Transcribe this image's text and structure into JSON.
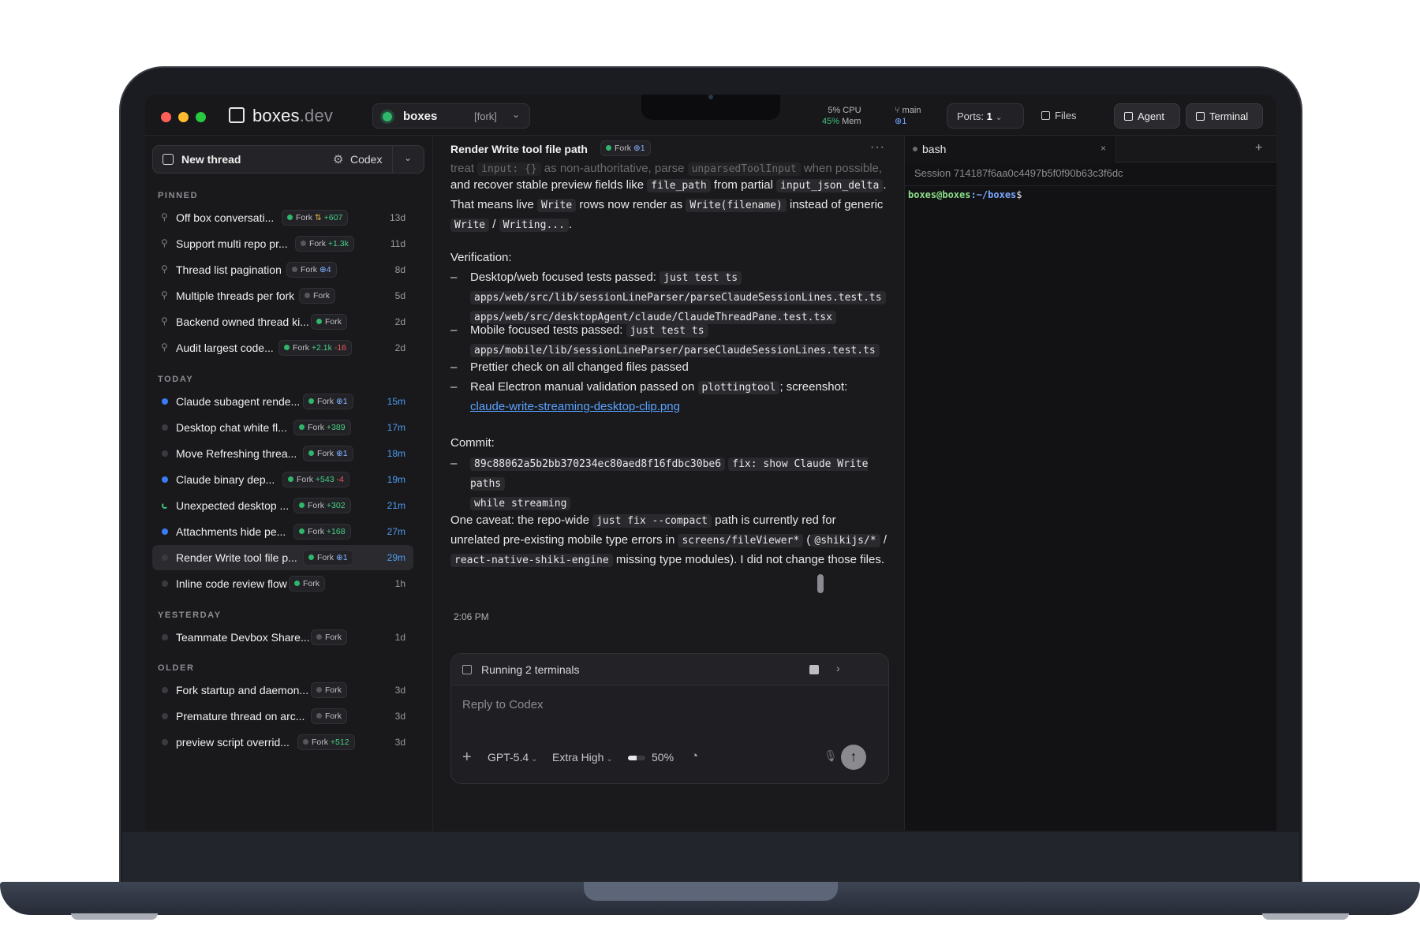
{
  "window": {
    "logo_main": "boxes",
    "logo_dim": ".dev",
    "repo": {
      "name": "boxes",
      "tag": "[fork]"
    },
    "stats": {
      "cpu": "5% CPU",
      "mem_pct": "45%",
      "mem_label": " Mem",
      "branch": "main",
      "pr": "⊕1"
    },
    "ports_label": "Ports:",
    "ports_count": "1",
    "files_label": "Files",
    "agent_label": "Agent",
    "terminal_label": "Terminal"
  },
  "sidebar": {
    "new_thread": "New thread",
    "agent": "Codex",
    "sections": {
      "pinned": "PINNED",
      "today": "TODAY",
      "yesterday": "YESTERDAY",
      "older": "OLDER"
    },
    "pinned": [
      {
        "title": "Off box conversati...",
        "fork": "Fork",
        "extra_icon": "⇅",
        "add": "+607",
        "del": "",
        "pr": "",
        "age": "13d"
      },
      {
        "title": "Support multi repo pr...",
        "fork": "Fork",
        "add": "+1.3k",
        "del": "",
        "pr": "",
        "age": "11d"
      },
      {
        "title": "Thread list pagination",
        "fork": "Fork",
        "add": "",
        "del": "",
        "pr": "⊕4",
        "age": "8d"
      },
      {
        "title": "Multiple threads per fork",
        "fork": "Fork",
        "add": "",
        "del": "",
        "pr": "",
        "age": "5d"
      },
      {
        "title": "Backend owned thread ki...",
        "fork": "Fork",
        "add": "",
        "del": "",
        "pr": "",
        "age": "2d"
      },
      {
        "title": "Audit largest code...",
        "fork": "Fork",
        "add": "+2.1k",
        "del": "-16",
        "pr": "",
        "age": "2d"
      }
    ],
    "today": [
      {
        "title": "Claude subagent rende...",
        "fork": "Fork",
        "add": "",
        "del": "",
        "pr": "⊕1",
        "age": "15m"
      },
      {
        "title": "Desktop chat white fl...",
        "fork": "Fork",
        "add": "+389",
        "del": "",
        "pr": "",
        "age": "17m"
      },
      {
        "title": "Move Refreshing threa...",
        "fork": "Fork",
        "add": "",
        "del": "",
        "pr": "⊕1",
        "age": "18m"
      },
      {
        "title": "Claude binary dep...",
        "fork": "Fork",
        "add": "+543",
        "del": "-4",
        "pr": "",
        "age": "19m"
      },
      {
        "title": "Unexpected desktop ...",
        "fork": "Fork",
        "add": "+302",
        "del": "",
        "pr": "",
        "age": "21m"
      },
      {
        "title": "Attachments hide pe...",
        "fork": "Fork",
        "add": "+168",
        "del": "",
        "pr": "",
        "age": "27m"
      },
      {
        "title": "Render Write tool file p...",
        "fork": "Fork",
        "add": "",
        "del": "",
        "pr": "⊕1",
        "age": "29m"
      },
      {
        "title": "Inline code review flow",
        "fork": "Fork",
        "add": "",
        "del": "",
        "pr": "",
        "age": "1h"
      }
    ],
    "yesterday": [
      {
        "title": "Teammate Devbox Share...",
        "fork": "Fork",
        "age": "1d"
      }
    ],
    "older": [
      {
        "title": "Fork startup and daemon...",
        "fork": "Fork",
        "add": "",
        "age": "3d"
      },
      {
        "title": "Premature thread on arc...",
        "fork": "Fork",
        "add": "",
        "age": "3d"
      },
      {
        "title": "preview script overrid...",
        "fork": "Fork",
        "add": "+512",
        "age": "3d"
      }
    ]
  },
  "chat": {
    "title": "Render Write tool file path",
    "fork": "Fork",
    "pr": "⊕1",
    "more": "···",
    "faded_line": {
      "t1": "treat ",
      "c1": "input: {}",
      "t2": " as non-authoritative, parse ",
      "c2": "unparsedToolInput",
      "t3": " when possible,"
    },
    "para1": {
      "t1": "and recover stable preview fields like ",
      "c1": "file_path",
      "t2": " from partial ",
      "c2": "input_json_delta",
      "t3": ".",
      "t4": "That means live ",
      "c3": "Write",
      "t5": " rows now render as ",
      "c4": "Write(filename)",
      "t6": " instead of generic",
      "c5": "Write",
      "t7": " / ",
      "c6": "Writing...",
      "t8": "."
    },
    "verification_label": "Verification:",
    "verification": [
      {
        "text": "Desktop/web focused tests passed: ",
        "cmd": "just test ts",
        "path1": "apps/web/src/lib/sessionLineParser/parseClaudeSessionLines.test.ts",
        "path2": "apps/web/src/desktopAgent/claude/ClaudeThreadPane.test.tsx"
      },
      {
        "text": "Mobile focused tests passed: ",
        "cmd": "just test ts",
        "path1": "apps/mobile/lib/sessionLineParser/parseClaudeSessionLines.test.ts"
      },
      {
        "text": "Prettier check on all changed files passed"
      },
      {
        "text": "Real Electron manual validation passed on ",
        "cmd": "plottingtool",
        "after": "; screenshot:",
        "link": "claude-write-streaming-desktop-clip.png"
      }
    ],
    "commit_label": "Commit:",
    "commit": {
      "hash": "89c88062a5b2bb370234ec80aed8f16fdbc30be6",
      "msg1": "fix: show Claude Write paths",
      "msg2": "while streaming"
    },
    "caveat": {
      "t1": "One caveat: the repo-wide ",
      "c1": "just fix --compact",
      "t2": " path is currently red for",
      "t3": "unrelated pre-existing mobile type errors in ",
      "c2": "screens/fileViewer*",
      "t4": " (",
      "c3": "@shikijs/*",
      "t5": " /",
      "c4": "react-native-shiki-engine",
      "t6": " missing type modules). I did not change those files."
    },
    "timestamp": "2:06 PM",
    "composer": {
      "running": "Running 2 terminals",
      "placeholder": "Reply to Codex",
      "model": "GPT-5.4",
      "effort": "Extra High",
      "context_pct": "50%",
      "context_fill": 0.5
    }
  },
  "terminal": {
    "tab": "bash",
    "close": "×",
    "add": "+",
    "session": "Session 714187f6aa0c4497b5f0f90b63c3f6dc",
    "user": "boxes@boxes",
    "path": ":~/boxes",
    "symbol": "$"
  },
  "colors": {
    "accent_green": "#2fb66a",
    "link_blue": "#5aa2ff",
    "pr_blue": "#7fb0ff",
    "add_green": "#46cf84",
    "del_red": "#ef5b5b"
  }
}
